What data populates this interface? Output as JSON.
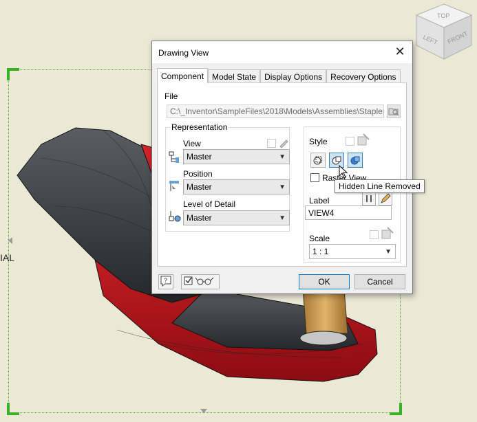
{
  "canvas": {
    "view_label_fragment": "IAL",
    "viewcube": {
      "top": "TOP",
      "left": "LEFT",
      "front": "FRONT"
    }
  },
  "dialog": {
    "title": "Drawing View",
    "close_icon": "close-icon",
    "tabs": [
      {
        "label": "Component",
        "active": true
      },
      {
        "label": "Model State",
        "active": false
      },
      {
        "label": "Display Options",
        "active": false
      },
      {
        "label": "Recovery Options",
        "active": false
      }
    ],
    "file": {
      "label": "File",
      "value": "C:\\_Inventor\\SampleFiles\\2018\\Models\\Assemblies\\Stapler\\S",
      "browse_icon": "folder-open-icon"
    },
    "representation": {
      "title": "Representation",
      "view": {
        "label": "View",
        "value": "Master",
        "icon": "view-representation-icon"
      },
      "position": {
        "label": "Position",
        "value": "Master",
        "icon": "positional-representation-icon"
      },
      "level_of_detail": {
        "label": "Level of Detail",
        "value": "Master",
        "icon": "level-of-detail-icon"
      }
    },
    "style": {
      "title": "Style",
      "buttons": [
        "hidden-line-icon",
        "hidden-line-removed-icon",
        "shaded-icon"
      ],
      "raster_view_label": "Raster View",
      "tooltip": "Hidden Line Removed"
    },
    "label": {
      "title": "Label",
      "value": "VIEW4"
    },
    "scale": {
      "title": "Scale",
      "value": "1 : 1"
    },
    "buttons": {
      "ok": "OK",
      "cancel": "Cancel"
    }
  },
  "colors": {
    "canvas_bg": "#ebe8d6",
    "view_border": "#38b02a",
    "stapler_red": "#c0161e",
    "stapler_dark": "#3a3c40",
    "accent": "#0078d7"
  }
}
